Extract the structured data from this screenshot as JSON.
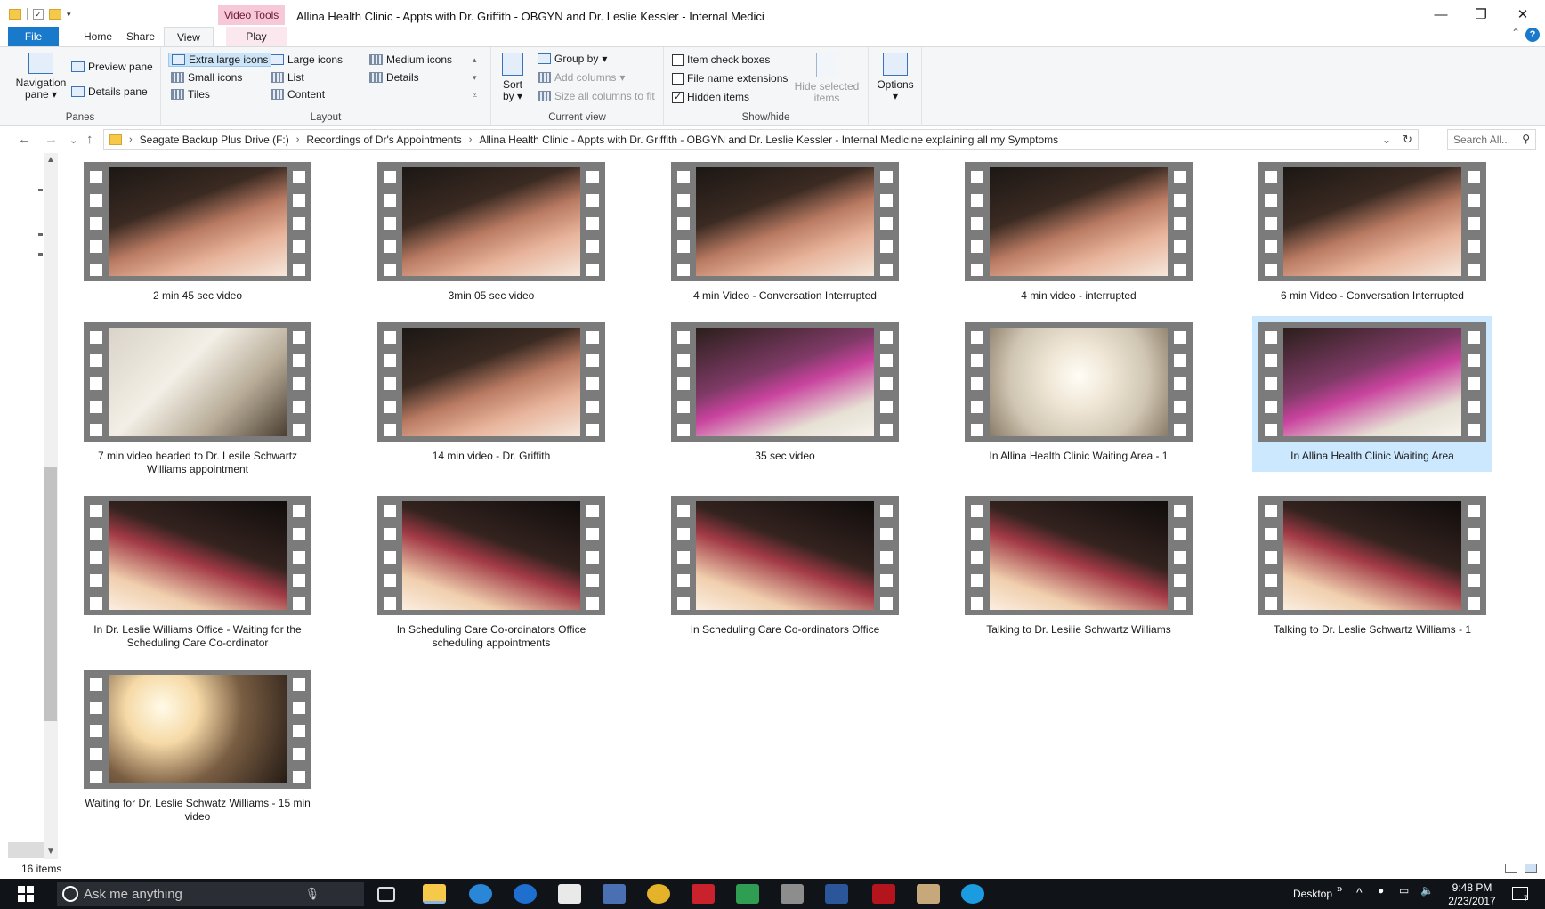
{
  "window": {
    "title": "Allina Health Clinic - Appts with Dr. Griffith - OBGYN and Dr. Leslie Kessler - Internal Medici",
    "context_tab": "Video Tools",
    "controls": {
      "minimize": "—",
      "restore": "❐",
      "close": "✕"
    }
  },
  "ribbon": {
    "tabs": [
      "File",
      "Home",
      "Share",
      "View",
      "Play"
    ],
    "active_tab": "View",
    "panes": {
      "label": "Panes",
      "navigation_pane": "Navigation pane",
      "preview_pane": "Preview pane",
      "details_pane": "Details pane"
    },
    "layout": {
      "label": "Layout",
      "extra_large_icons": "Extra large icons",
      "large_icons": "Large icons",
      "medium_icons": "Medium icons",
      "small_icons": "Small icons",
      "list": "List",
      "details": "Details",
      "tiles": "Tiles",
      "content": "Content"
    },
    "current_view": {
      "label": "Current view",
      "sort_by": "Sort by",
      "group_by": "Group by",
      "add_columns": "Add columns",
      "size_all_columns": "Size all columns to fit"
    },
    "show_hide": {
      "label": "Show/hide",
      "item_check_boxes": "Item check boxes",
      "item_check_boxes_checked": false,
      "file_name_extensions": "File name extensions",
      "file_name_extensions_checked": false,
      "hidden_items": "Hidden items",
      "hidden_items_checked": true,
      "hide_selected_items": "Hide selected items"
    },
    "options": "Options"
  },
  "address_bar": {
    "path": [
      "Seagate Backup Plus Drive (F:)",
      "Recordings of Dr's Appointments",
      "Allina Health Clinic - Appts with Dr. Griffith - OBGYN and Dr. Leslie Kessler - Internal Medicine explaining all my Symptoms"
    ],
    "search_placeholder": "Search All..."
  },
  "files": [
    {
      "name": "2 min 45 sec video",
      "scene": "chair",
      "selected": false
    },
    {
      "name": "3min 05 sec video",
      "scene": "chair",
      "selected": false
    },
    {
      "name": "4 min Video - Conversation Interrupted",
      "scene": "chair",
      "selected": false
    },
    {
      "name": "4 min video - interrupted",
      "scene": "chair",
      "selected": false
    },
    {
      "name": "6 min Video - Conversation Interrupted",
      "scene": "chair",
      "selected": false
    },
    {
      "name": "7 min video headed to Dr. Lesile Schwartz Williams appointment",
      "scene": "ceiling",
      "selected": false
    },
    {
      "name": "14 min video - Dr. Griffith",
      "scene": "chair",
      "selected": false
    },
    {
      "name": "35 sec video",
      "scene": "pink",
      "selected": false
    },
    {
      "name": "In Allina Health Clinic Waiting Area - 1",
      "scene": "bright",
      "selected": false
    },
    {
      "name": "In Allina Health Clinic Waiting Area",
      "scene": "pink",
      "selected": true
    },
    {
      "name": "In Dr. Leslie Williams Office  - Waiting for the Scheduling Care Co-ordinator",
      "scene": "dark",
      "selected": false
    },
    {
      "name": "In Scheduling Care Co-ordinators Office scheduling appointments",
      "scene": "dark",
      "selected": false
    },
    {
      "name": "In Scheduling Care Co-ordinators Office",
      "scene": "dark",
      "selected": false
    },
    {
      "name": "Talking to Dr. Lesilie Schwartz Williams",
      "scene": "dark",
      "selected": false
    },
    {
      "name": "Talking to Dr. Leslie Schwartz Williams - 1",
      "scene": "dark",
      "selected": false
    },
    {
      "name": "Waiting for Dr. Leslie Schwatz Williams - 15 min video",
      "scene": "lamp",
      "selected": false
    }
  ],
  "status": {
    "item_count": "16 items"
  },
  "taskbar": {
    "search_placeholder": "Ask me anything",
    "desktop_label": "Desktop",
    "time": "9:48 PM",
    "date": "2/23/2017",
    "notification_count": "7"
  }
}
